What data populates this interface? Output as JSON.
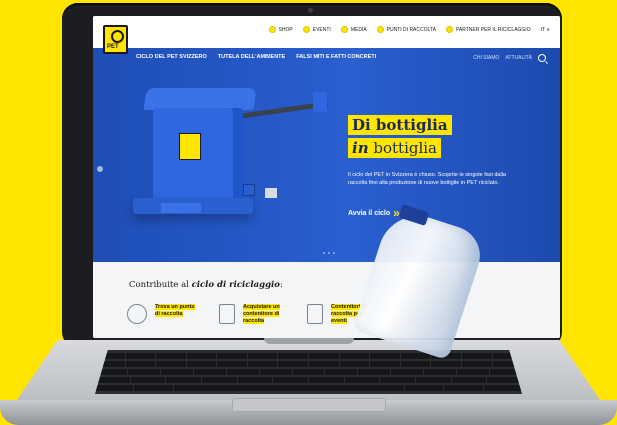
{
  "logo": {
    "text": "PET"
  },
  "utility_nav": [
    {
      "label": "SHOP"
    },
    {
      "label": "EVENTI"
    },
    {
      "label": "MEDIA"
    },
    {
      "label": "PUNTI DI RACCOLTA"
    },
    {
      "label": "PARTNER PER IL RICICLAGGIO"
    },
    {
      "label": "IT ∨"
    }
  ],
  "main_nav": [
    {
      "label": "CICLO DEL PET SVIZZERO"
    },
    {
      "label": "TUTELA DELL'AMBIENTE"
    },
    {
      "label": "FALSI MITI E FATTI CONCRETI"
    }
  ],
  "nav_right": {
    "about": "CHI SIAMO",
    "news": "ATTUALITÀ"
  },
  "hero": {
    "title_line1": "Di bottiglia",
    "title_line2_prefix": "in",
    "title_line2_suffix": " bottiglia",
    "description": "Il ciclo del PET in Svizzera è chiuso. Scoprite le singole fasi dalla raccolta fino alla produzione di nuove bottiglie in PET riciclato.",
    "cta_label": "Avvia il ciclo",
    "slide_count": 3
  },
  "lower": {
    "title_prefix": "Contribuite al ",
    "title_em": "ciclo di riciclaggio",
    "title_suffix": ":",
    "cards": [
      {
        "label": "Trova un punto di raccolta",
        "icon": "map-pin-icon"
      },
      {
        "label": "Acquistare un contenitore di raccolta",
        "icon": "bin-icon"
      },
      {
        "label": "Contenitori di raccolta per eventi",
        "icon": "event-bin-icon"
      }
    ]
  },
  "colors": {
    "brand_yellow": "#FFE500",
    "hero_blue": "#2a5fd0"
  }
}
